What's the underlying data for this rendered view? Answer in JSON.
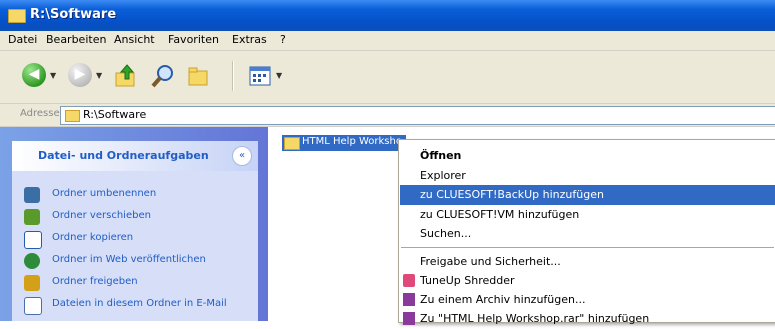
{
  "window": {
    "title": "R:\\Software"
  },
  "menubar": {
    "items": [
      "Datei",
      "Bearbeiten",
      "Ansicht",
      "Favoriten",
      "Extras",
      "?"
    ]
  },
  "toolbar": {
    "back_icon": "back-arrow-icon",
    "forward_icon": "forward-arrow-icon",
    "up_icon": "folder-up-icon",
    "search_icon": "search-icon",
    "folders_icon": "folders-icon",
    "views_icon": "views-icon"
  },
  "address": {
    "label": "Adresse",
    "value": "R:\\Software"
  },
  "tasks": {
    "header": "Datei- und Ordneraufgaben",
    "collapse_glyph": "«",
    "items": [
      {
        "label": "Ordner umbenennen",
        "color": "#3a6ea5"
      },
      {
        "label": "Ordner verschieben",
        "color": "#5a9a2a"
      },
      {
        "label": "Ordner kopieren",
        "color": "#2a5ba8"
      },
      {
        "label": "Ordner im Web veröffentlichen",
        "color": "#2e8b3a"
      },
      {
        "label": "Ordner freigeben",
        "color": "#d4a017"
      },
      {
        "label": "Dateien in diesem Ordner in E-Mail",
        "color": "#4a6fa5"
      }
    ]
  },
  "files": {
    "selected": "HTML Help Worksho"
  },
  "context_menu": {
    "items": [
      {
        "label": "Öffnen",
        "bold": true,
        "highlight": false
      },
      {
        "label": "Explorer",
        "bold": false,
        "highlight": false
      },
      {
        "label": "zu CLUESOFT!BackUp hinzufügen",
        "bold": false,
        "highlight": true
      },
      {
        "label": "zu CLUESOFT!VM hinzufügen",
        "bold": false,
        "highlight": false
      },
      {
        "label": "Suchen...",
        "bold": false,
        "highlight": false
      },
      {
        "label": "Freigabe und Sicherheit...",
        "bold": false,
        "highlight": false
      },
      {
        "label": "TuneUp Shredder",
        "bold": false,
        "highlight": false
      },
      {
        "label": "Zu einem Archiv hinzufügen...",
        "bold": false,
        "highlight": false
      },
      {
        "label": "Zu \"HTML Help Workshop.rar\" hinzufügen",
        "bold": false,
        "highlight": false
      }
    ]
  },
  "colors": {
    "title_bar": "#0551c9",
    "highlight": "#316ac5",
    "task_link": "#215dc6"
  }
}
